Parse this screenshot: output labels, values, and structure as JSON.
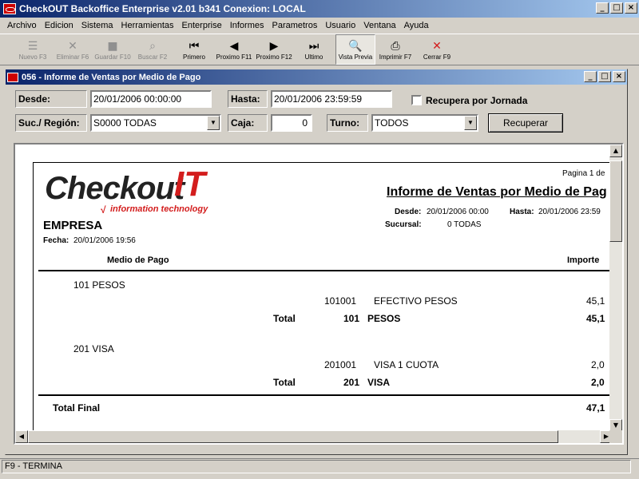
{
  "app": {
    "title": "CheckOUT Backoffice Enterprise v2.01 b341 Conexion: LOCAL"
  },
  "menu": [
    "Archivo",
    "Edicion",
    "Sistema",
    "Herramientas",
    "Enterprise",
    "Informes",
    "Parametros",
    "Usuario",
    "Ventana",
    "Ayuda"
  ],
  "toolbar": [
    {
      "label": "Nuevo F3",
      "icon": "new-icon",
      "glyph": "☰",
      "enabled": false
    },
    {
      "label": "Eliminar F6",
      "icon": "delete-icon",
      "glyph": "✕",
      "enabled": false
    },
    {
      "label": "Guardar F10",
      "icon": "save-icon",
      "glyph": "■",
      "enabled": false
    },
    {
      "label": "Buscar F2",
      "icon": "binoculars-icon",
      "glyph": "⌕",
      "enabled": false
    },
    {
      "label": "Primero",
      "icon": "first-icon",
      "glyph": "⏮",
      "enabled": true
    },
    {
      "label": "Proximo F11",
      "icon": "prev-icon",
      "glyph": "◀",
      "enabled": true
    },
    {
      "label": "Proximo F12",
      "icon": "next-icon",
      "glyph": "▶",
      "enabled": true
    },
    {
      "label": "Ultimo",
      "icon": "last-icon",
      "glyph": "⏭",
      "enabled": true
    },
    {
      "label": "Vista Previa",
      "icon": "preview-icon",
      "glyph": "🔍",
      "enabled": true,
      "pressed": true
    },
    {
      "label": "Imprimir F7",
      "icon": "printer-icon",
      "glyph": "⎙",
      "enabled": true
    },
    {
      "label": "Cerrar F9",
      "icon": "close-red-icon",
      "glyph": "✕",
      "enabled": true
    }
  ],
  "child": {
    "title": "056 - Informe de Ventas por Medio de Pago"
  },
  "form": {
    "desde_label": "Desde:",
    "desde_value": "20/01/2006 00:00:00",
    "hasta_label": "Hasta:",
    "hasta_value": "20/01/2006 23:59:59",
    "jornada_label": "Recupera por Jornada",
    "suc_label": "Suc./ Región:",
    "suc_value": "S0000 TODAS",
    "caja_label": "Caja:",
    "caja_value": "0",
    "turno_label": "Turno:",
    "turno_value": "TODOS",
    "recuperar_label": "Recuperar"
  },
  "report": {
    "logo_main": "Checkout",
    "logo_it": "IT",
    "logo_sub": "information technology",
    "page_label": "Pagina 1 de",
    "title": "Informe de Ventas por Medio de Pag",
    "empresa": "EMPRESA",
    "fecha_label": "Fecha:",
    "fecha_value": "20/01/2006 19:56",
    "desde_label": "Desde:",
    "desde_value": "20/01/2006 00:00",
    "hasta_label": "Hasta:",
    "hasta_value": "20/01/2006 23:59",
    "sucursal_label": "Sucursal:",
    "sucursal_value": "0 TODAS",
    "col_medio": "Medio de Pago",
    "col_importe": "Importe",
    "groups": [
      {
        "header": "101  PESOS",
        "detail_code": "101001",
        "detail_name": "EFECTIVO PESOS",
        "detail_amount": "45,1",
        "total_label": "Total",
        "total_code": "101",
        "total_name": "PESOS",
        "total_amount": "45,1"
      },
      {
        "header": "201  VISA",
        "detail_code": "201001",
        "detail_name": "VISA 1 CUOTA",
        "detail_amount": "2,0",
        "total_label": "Total",
        "total_code": "201",
        "total_name": "VISA",
        "total_amount": "2,0"
      }
    ],
    "final_label": "Total Final",
    "final_amount": "47,1"
  },
  "status": {
    "text": "F9 - TERMINA"
  }
}
